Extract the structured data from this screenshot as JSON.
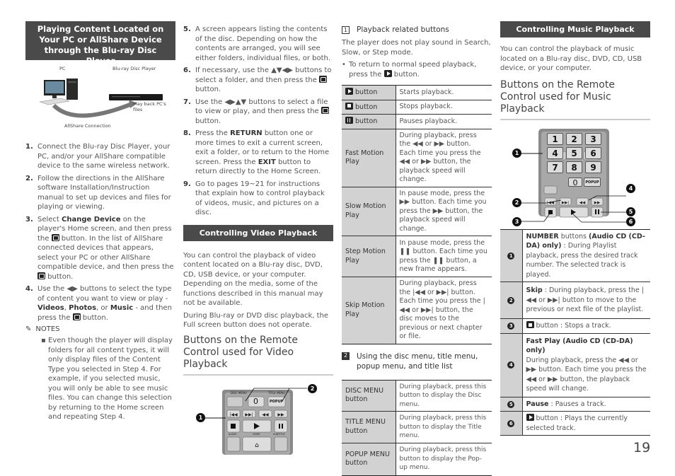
{
  "page_number": "19",
  "col1": {
    "banner": "Playing Content Located on Your PC or AllShare Device through the Blu-ray Disc Player",
    "diagram": {
      "pc_label": "PC",
      "player_label": "Blu-ray Disc Player",
      "playback_label": "Play back PC's files",
      "connection_label": "AllShare Connection"
    },
    "steps": [
      {
        "num": "1.",
        "text": "Connect the Blu-ray Disc Player, your PC, and/or your AllShare compatible device to the same wireless network."
      },
      {
        "num": "2.",
        "text": "Follow the directions in the AllShare software Installation/Instruction manual to set up devices and files for playing or viewing."
      },
      {
        "num": "3.",
        "pre": "Select ",
        "bold": "Change Device",
        "mid": " on the player's Home screen, and then press the ",
        "mid2": " button. In the list of AllShare connected devices that appears, select your PC or other AllShare compatible device, and then press the ",
        "post": " button."
      },
      {
        "num": "4.",
        "pre": "Use the ◀▶ buttons to select the type of content you want to view or play - ",
        "b1": "Videos",
        "s1": ", ",
        "b2": "Photos",
        "s2": ", or ",
        "b3": "Music",
        "s3": " - and then press the ",
        "post": " button."
      }
    ],
    "notes_title": "NOTES",
    "notes": [
      "Even though the player will display folders for all content types, it will only display files of the Content Type you selected in Step 4. For example, if you selected music, you will only be able to see music files. You can change this selection by returning to the Home screen and repeating Step 4."
    ]
  },
  "col2": {
    "steps": [
      {
        "num": "5.",
        "text": "A screen appears listing the contents of the disc. Depending on how the contents are arranged, you will see either folders, individual files, or both."
      },
      {
        "num": "6.",
        "pre": "If necessary, use the ▲▼◀▶ buttons to select a folder, and then press the ",
        "post": " button."
      },
      {
        "num": "7.",
        "pre": "Use the ◀▶▲▼ buttons to select a file to view or play, and then press the ",
        "post": " button."
      },
      {
        "num": "8.",
        "pre": "Press the ",
        "b1": "RETURN",
        "mid": " button one or more times to exit a current screen, exit a folder, or to return to the Home screen. Press the ",
        "b2": "EXIT",
        "post": " button to return directly to the Home Screen."
      },
      {
        "num": "9.",
        "text": "Go to pages 19~21 for instructions that explain how to control playback of videos, music, and pictures on a disc."
      }
    ],
    "banner": "Controlling Video Playback",
    "para1": "You can control the playback of video content located on a Blu-ray disc, DVD, CD, USB device, or your computer. Depending on the media, some of the functions described in this manual may not be available.",
    "para2": "During Blu-ray or DVD disc playback, the Full screen button does not operate.",
    "heading": "Buttons on the Remote Control used for Video Playback",
    "remote": {
      "disc_menu": "DISC MENU",
      "title_menu": "TITLE MENU",
      "zero": "0",
      "popup": "POPUP",
      "audio": "AUDIO",
      "home": "HOME",
      "subtitle": "SUBTITLE",
      "callout1": "1",
      "callout2": "2"
    }
  },
  "col3": {
    "sub1_num": "1",
    "sub1_title": "Playback related buttons",
    "sub1_para": "The player does not play sound in Search, Slow, or Step mode.",
    "sub1_bullet_pre": "To return to normal speed playback, press the ",
    "sub1_bullet_post": " button.",
    "table1": [
      {
        "icon": "play",
        "key": "button",
        "desc": "Starts playback."
      },
      {
        "icon": "stop",
        "key": "button",
        "desc": "Stops playback."
      },
      {
        "icon": "pause",
        "key": "button",
        "desc": "Pauses playback."
      },
      {
        "key": "Fast Motion Play",
        "desc": "During playback, press the ◀◀ or ▶▶ button. Each time you press the ◀◀ or ▶▶ button, the playback speed will change."
      },
      {
        "key": "Slow Motion Play",
        "desc": "In pause mode, press the ▶▶ button. Each time you press the ▶▶ button, the playback speed will change."
      },
      {
        "key": "Step Motion Play",
        "desc": "In pause mode, press the ❚❚ button. Each time you press the ❚❚ button, a new frame appears."
      },
      {
        "key": "Skip Motion Play",
        "desc": "During playback, press the |◀◀ or ▶▶| button. Each time you press the |◀◀ or ▶▶| button, the disc moves to the previous or next chapter or file."
      }
    ],
    "sub2_num": "2",
    "sub2_title": "Using the disc menu, title menu, popup menu, and title list",
    "table2": [
      {
        "key": "DISC MENU button",
        "desc": "During playback, press this button to display the Disc menu."
      },
      {
        "key": "TITLE MENU button",
        "desc": "During playback, press this button to display the Title menu."
      },
      {
        "key": "POPUP MENU button",
        "desc": "During playback, press this button to  display the Pop-up menu."
      }
    ]
  },
  "col4": {
    "banner": "Controlling Music Playback",
    "para": "You can control the playback of music located on a Blu-ray disc, DVD, CD, USB device, or your computer.",
    "heading": "Buttons on the Remote Control used for Music Playback",
    "remote": {
      "keys": [
        "1",
        "2",
        "3",
        "4",
        "5",
        "6",
        "7",
        "8",
        "9"
      ],
      "zero": "0",
      "popup": "POPUP",
      "callouts": [
        "1",
        "2",
        "3",
        "4",
        "5",
        "6"
      ]
    },
    "table": [
      {
        "n": "1",
        "b1": "NUMBER",
        "t1": " buttons ",
        "b2": "(Audio CD (CD-DA) only)",
        "t2": " : During Playlist playback, press the desired track number. The selected track is played."
      },
      {
        "n": "2",
        "b1": "Skip",
        "t1": " : During playback, press the |◀◀ or ▶▶| button to move to the previous or next file of the playlist."
      },
      {
        "n": "3",
        "t1": " button : Stops a track."
      },
      {
        "n": "4",
        "b1": "Fast Play (Audio CD (CD-DA) only)",
        "t1": "During playback, press the ◀◀ or ▶▶ button. Each time you press the ◀◀ or ▶▶ button, the playback speed will change."
      },
      {
        "n": "5",
        "b1": "Pause",
        "t1": " : Pauses a track."
      },
      {
        "n": "6",
        "t1": " button : Plays the currently selected track."
      }
    ]
  }
}
